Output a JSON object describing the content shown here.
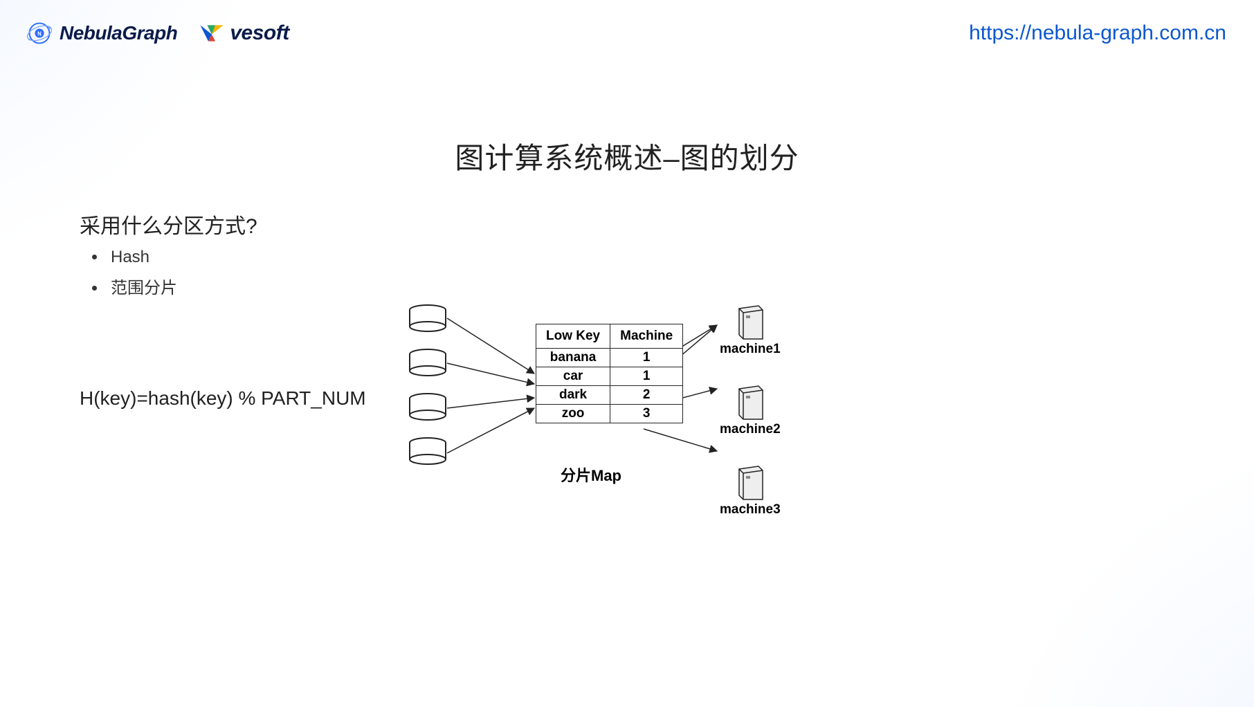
{
  "header": {
    "logo1_main": "Nebula",
    "logo1_sub": "Graph",
    "logo2": "vesoft",
    "url": "https://nebula-graph.com.cn"
  },
  "title": "图计算系统概述–图的划分",
  "question": "采用什么分区方式?",
  "bullets": [
    "Hash",
    "范围分片"
  ],
  "formula": "H(key)=hash(key) % PART_NUM",
  "map": {
    "header": {
      "col1": "Low Key",
      "col2": "Machine"
    },
    "rows": [
      {
        "key": "banana",
        "machine": "1"
      },
      {
        "key": "car",
        "machine": "1"
      },
      {
        "key": "dark",
        "machine": "2"
      },
      {
        "key": "zoo",
        "machine": "3"
      }
    ],
    "label": "分片Map"
  },
  "machines": [
    "machine1",
    "machine2",
    "machine3"
  ]
}
